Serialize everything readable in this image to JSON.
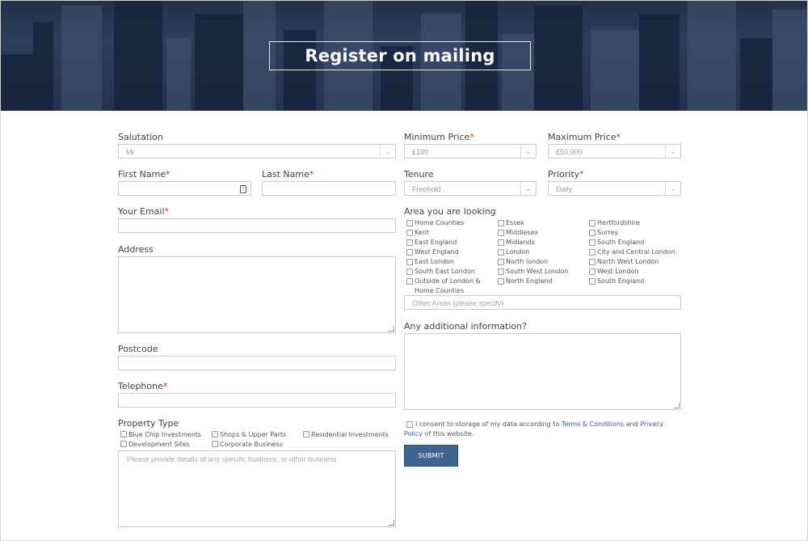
{
  "header": {
    "title": "Register on mailing"
  },
  "form": {
    "salutation": {
      "label": "Salutation",
      "value": "Mr"
    },
    "min_price": {
      "label": "Minimum Price",
      "value": "£100"
    },
    "max_price": {
      "label": "Maximum Price",
      "value": "£50,000"
    },
    "first_name": {
      "label": "First Name"
    },
    "last_name": {
      "label": "Last Name"
    },
    "tenure": {
      "label": "Tenure",
      "value": "Freehold"
    },
    "priority": {
      "label": "Priority",
      "value": "Daily"
    },
    "email": {
      "label": "Your Email"
    },
    "area": {
      "label": "Area you are looking",
      "options": [
        "Home Counties",
        "Essex",
        "Hertfordshire",
        "Kent",
        "Middlesex",
        "Surrey",
        "East England",
        "Midlands",
        "South England",
        "West England",
        "London",
        "City and Central London",
        "East London",
        "North london",
        "North West London",
        "South East London",
        "South West London",
        "West London",
        "Outside of London &",
        "North England",
        "South England"
      ],
      "outside_line2": "Home Counties",
      "other_placeholder": "Other Areas (please specify)"
    },
    "address": {
      "label": "Address"
    },
    "additional": {
      "label": "Any additional information?"
    },
    "postcode": {
      "label": "Postcode"
    },
    "telephone": {
      "label": "Telephone"
    },
    "property_type": {
      "label": "Property Type",
      "options": [
        "Blue Chip Investments",
        "Shops & Upper Parts",
        "Residential Investments",
        "Development Sites",
        "Corporate Business"
      ],
      "details_placeholder": "Please provide details of any specific business, or other business"
    },
    "required_mark": "*",
    "consent": {
      "text_before": "I consent to storage of my data according to ",
      "terms": "Terms & Conditions",
      "and": " and ",
      "privacy": "Privacy Policy",
      "text_after": " of this website."
    },
    "submit_label": "SUBMIT"
  },
  "icons": {
    "dropdown": "chevron-down-icon",
    "password_key": "key-icon"
  },
  "colors": {
    "accent": "#3f6691",
    "required": "#d0322d",
    "link": "#3a57c8"
  }
}
